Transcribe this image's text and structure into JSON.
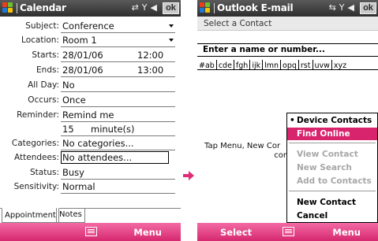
{
  "colors": {
    "titlebar": "#3c3c3c",
    "softbar": "#e23f86",
    "accent": "#d8246d",
    "arrow": "#e02b76"
  },
  "left_screen": {
    "title": "Calendar",
    "ok_label": "ok",
    "fields": {
      "subject": {
        "label": "Subject:",
        "value": "Conference"
      },
      "location": {
        "label": "Location:",
        "value": "Room 1"
      },
      "starts": {
        "label": "Starts:",
        "date": "28/01/06",
        "time": "12:00"
      },
      "ends": {
        "label": "Ends:",
        "date": "28/01/06",
        "time": "13:00"
      },
      "allday": {
        "label": "All Day:",
        "value": "No"
      },
      "occurs": {
        "label": "Occurs:",
        "value": "Once"
      },
      "reminder": {
        "label": "Reminder:",
        "value": "Remind me",
        "amount": "15",
        "unit": "minute(s)"
      },
      "categories": {
        "label": "Categories:",
        "value": "No categories..."
      },
      "attendees": {
        "label": "Attendees:",
        "value": "No attendees..."
      },
      "status": {
        "label": "Status:",
        "value": "Busy"
      },
      "sensitivity": {
        "label": "Sensitivity:",
        "value": "Normal"
      }
    },
    "tabs": [
      "Appointment",
      "Notes"
    ],
    "softkeys": {
      "left": "",
      "right": "Menu"
    }
  },
  "right_screen": {
    "title": "Outlook E-mail",
    "ok_label": "ok",
    "subheader": "Select a Contact",
    "search_placeholder": "Enter a name or number...",
    "alpha_groups": [
      "#ab",
      "cde",
      "fgh",
      "ijk",
      "lmn",
      "opq",
      "rst",
      "uvw",
      "xyz"
    ],
    "empty_message_line1": "Tap Menu, New Cor",
    "empty_message_line2": "cor",
    "menu": {
      "device_contacts": "Device Contacts",
      "find_online": "Find Online",
      "view_contact": "View Contact",
      "new_search": "New Search",
      "add_to_contacts": "Add to Contacts",
      "new_contact": "New Contact",
      "cancel": "Cancel"
    },
    "softkeys": {
      "left": "Select",
      "right": "Menu"
    }
  },
  "icons": {
    "start": "windows-start-icon",
    "connectivity": "connectivity-icon",
    "signal": "signal-icon",
    "volume": "volume-icon",
    "keyboard": "keyboard-icon",
    "arrow": "right-arrow-icon"
  }
}
